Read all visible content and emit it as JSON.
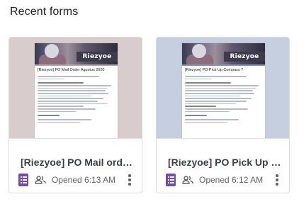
{
  "section": {
    "title": "Recent forms"
  },
  "cards": [
    {
      "title": "[Riezyoe] PO Mail order A...",
      "opened": "Opened 6:13 AM",
      "thumbnail_brand": "Riezyoe",
      "thumbnail_title": "[Riezyoe] PO Mail Order Agustus 2020",
      "accent_color": "#b9a7a8"
    },
    {
      "title": "[Riezyoe] PO Pick Up Co...",
      "opened": "Opened 6:12 AM",
      "thumbnail_brand": "Riezyoe",
      "thumbnail_title": "[Riezyoe] PO Pick Up Compass 7",
      "accent_color": "#7f96bd"
    }
  ],
  "colors": {
    "forms_icon": "#7248b9",
    "text_secondary": "#5f6368"
  },
  "icons": {
    "app": "google-forms-icon",
    "shared": "people-icon",
    "menu": "more-vert-icon"
  }
}
